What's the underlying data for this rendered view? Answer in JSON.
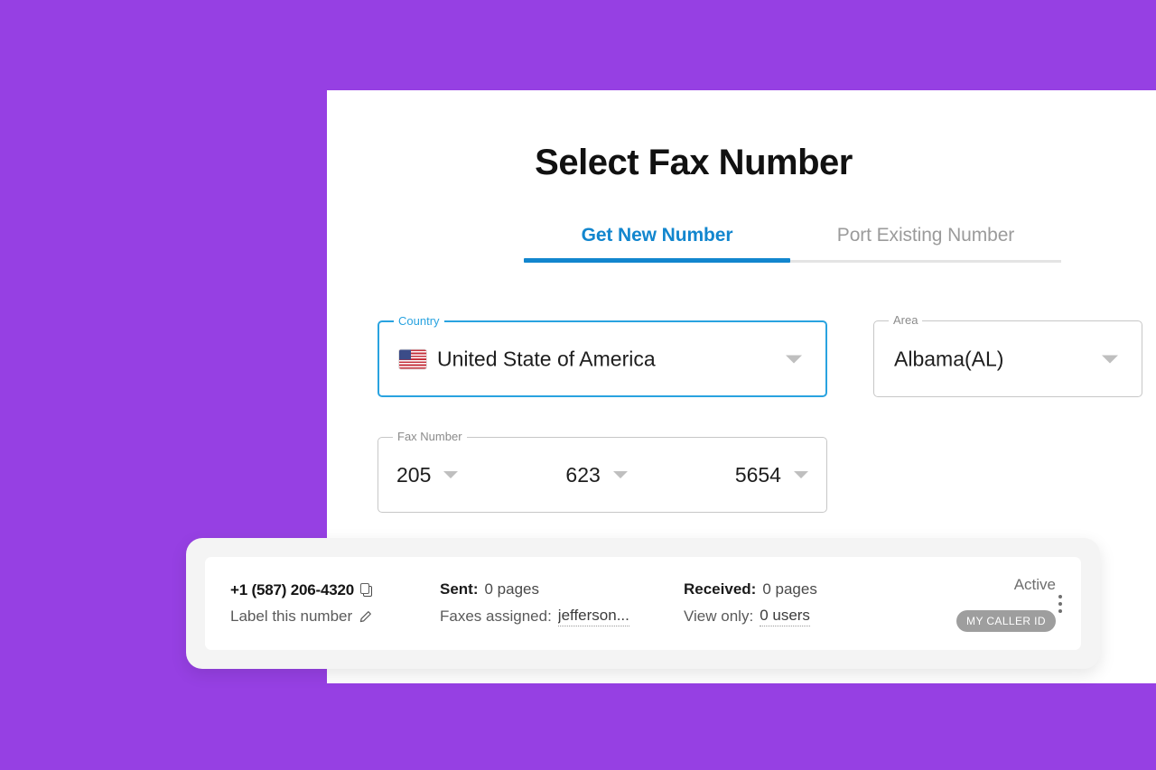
{
  "theme": {
    "background_color": "#9640E3",
    "panel_color": "#ffffff",
    "accent_blue": "#1286CE",
    "focus_blue": "#29A3E0",
    "badge_gray": "#9E9E9E"
  },
  "header": {
    "title": "Select Fax Number"
  },
  "tabs": [
    {
      "label": "Get New Number",
      "active": true
    },
    {
      "label": "Port Existing Number",
      "active": false
    }
  ],
  "form": {
    "country": {
      "legend": "Country",
      "value": "United State of America",
      "flag": "us-flag-icon",
      "focused": true
    },
    "area": {
      "legend": "Area",
      "value": "Albama(AL)",
      "focused": false
    },
    "fax_number": {
      "legend": "Fax Number",
      "segments": [
        "205",
        "623",
        "5654"
      ]
    }
  },
  "number_card": {
    "phone_number": "+1 (587) 206-4320",
    "copy_icon": "copy-icon",
    "label_action": "Label this number",
    "edit_icon": "pencil-icon",
    "sent_key": "Sent:",
    "sent_value": "0 pages",
    "faxes_assigned_key": "Faxes assigned:",
    "faxes_assigned_value": "jefferson...",
    "received_key": "Received:",
    "received_value": "0 pages",
    "view_only_key": "View only:",
    "view_only_value": "0 users",
    "status": "Active",
    "caller_id_badge": "MY CALLER ID",
    "menu_icon": "kebab-menu-icon"
  }
}
